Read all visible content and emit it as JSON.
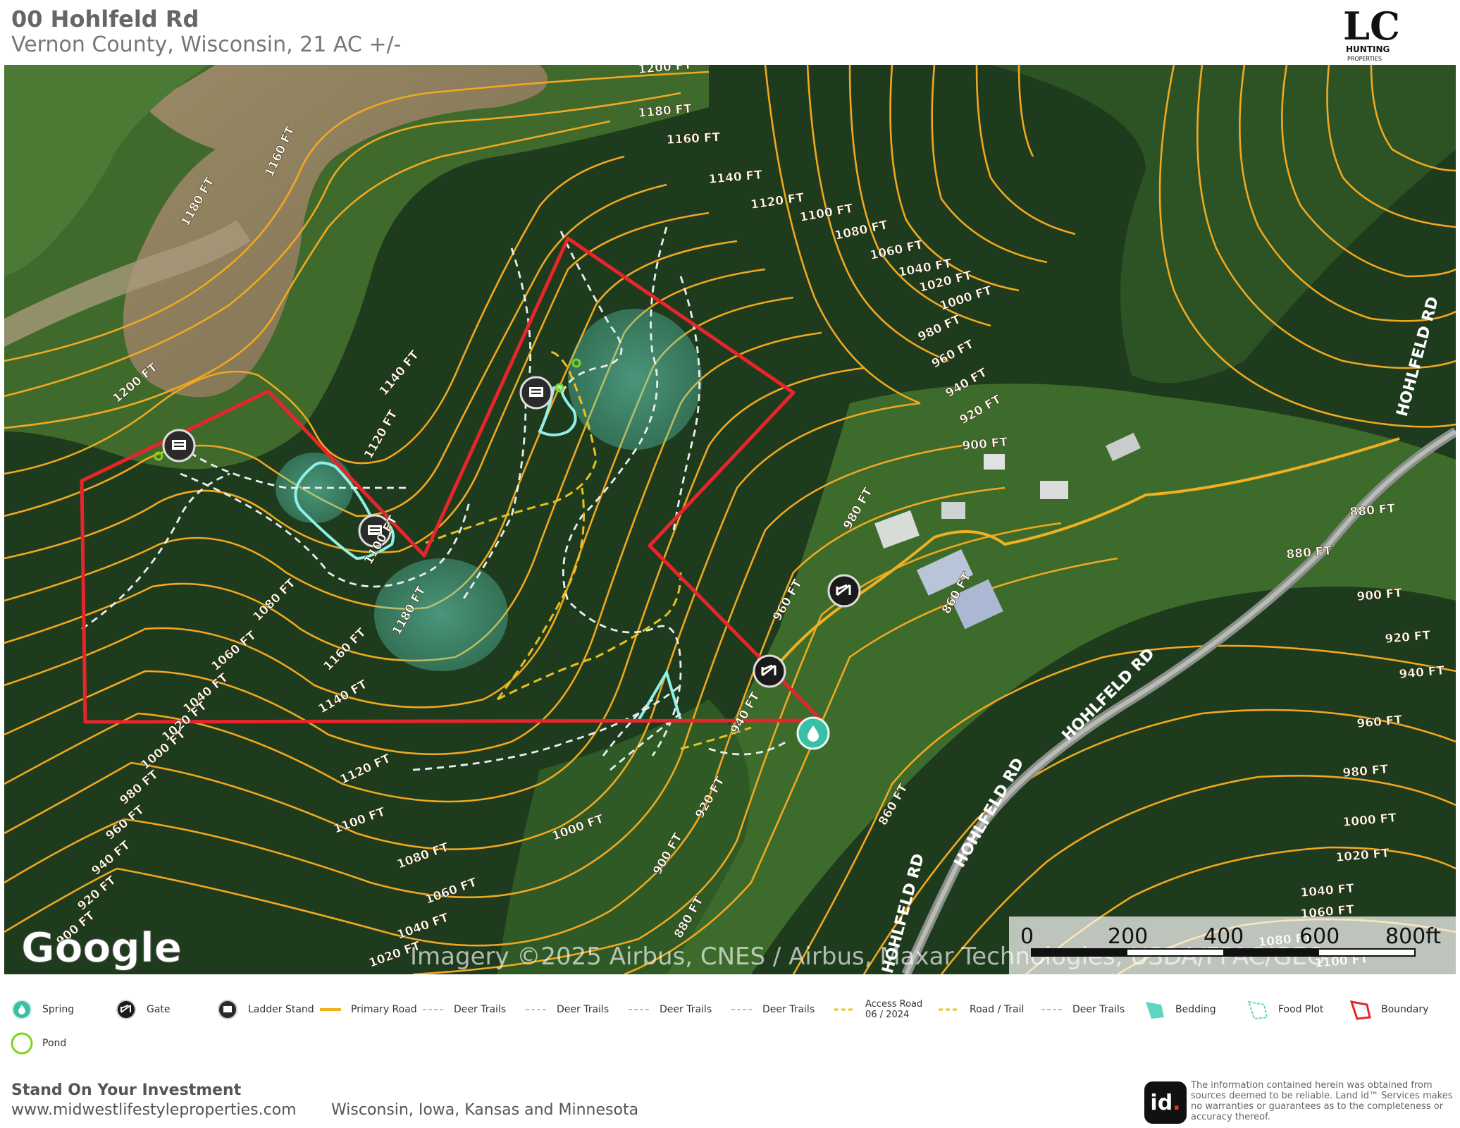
{
  "header": {
    "title": "00 Hohlfeld Rd",
    "subtitle": "Vernon County, Wisconsin, 21 AC +/-"
  },
  "logo": {
    "letters": "LC",
    "line1": "HUNTING",
    "line2": "PROPERTIES"
  },
  "map": {
    "attribution_google": "Google",
    "attribution_imagery": "Imagery ©2025 Airbus, CNES / Airbus, Maxar Technologies, USDA/FPAC/GEO",
    "scale_labels": [
      "0",
      "200",
      "400",
      "600",
      "800ft"
    ],
    "road_labels": [
      "HOHLFELD RD",
      "HOHLFELD RD",
      "HOHLFELD RD",
      "HOHLFELD RD"
    ],
    "contour_labels": [
      "1200 FT",
      "1180 FT",
      "1160 FT",
      "1140 FT",
      "1120 FT",
      "1100 FT",
      "1080 FT",
      "1060 FT",
      "1040 FT",
      "1020 FT",
      "1000 FT",
      "980 FT",
      "960 FT",
      "940 FT",
      "920 FT",
      "900 FT",
      "880 FT",
      "860 FT",
      "1200 FT",
      "1180 FT",
      "1160 FT",
      "1140 FT",
      "1120 FT",
      "1100 FT",
      "1080 FT",
      "1060 FT",
      "1040 FT",
      "1020 FT",
      "1000 FT",
      "980 FT",
      "960 FT",
      "940 FT",
      "920 FT",
      "900 FT",
      "880 FT",
      "900 FT",
      "920 FT",
      "940 FT",
      "960 FT",
      "980 FT",
      "1000 FT",
      "1020 FT",
      "1040 FT",
      "1060 FT",
      "1080 FT",
      "1100 FT",
      "1180 FT",
      "1160 FT",
      "1140 FT",
      "1120 FT",
      "1100 FT",
      "1080 FT",
      "1060 FT",
      "1040 FT",
      "1020 FT",
      "1000 FT",
      "980 FT",
      "960 FT",
      "940 FT",
      "920 FT",
      "900 FT",
      "880 FT",
      "860 FT"
    ],
    "colors": {
      "boundary": "#e8252a",
      "contour": "#f0a820",
      "deer_trail": "#e8eef0",
      "access_road": "#e8c020",
      "food_plot": "#8ff0e8",
      "bedding": "#5cd6c0",
      "pond": "#7ed321",
      "spring": "#39bfa6"
    }
  },
  "legend": {
    "items": [
      {
        "label": "Spring",
        "icon": "spring-icon"
      },
      {
        "label": "Gate",
        "icon": "gate-icon"
      },
      {
        "label": "Ladder Stand",
        "icon": "ladder-stand-icon"
      },
      {
        "label": "Primary Road",
        "icon": "primary-road-icon"
      },
      {
        "label": "Deer Trails",
        "icon": "deer-trail-icon"
      },
      {
        "label": "Deer Trails",
        "icon": "deer-trail-icon"
      },
      {
        "label": "Deer Trails",
        "icon": "deer-trail-icon"
      },
      {
        "label": "Deer Trails",
        "icon": "deer-trail-icon"
      },
      {
        "label": "Access Road",
        "label2": "06 / 2024",
        "icon": "access-road-icon"
      },
      {
        "label": "Road / Trail",
        "icon": "road-trail-icon"
      },
      {
        "label": "Deer Trails",
        "icon": "deer-trail-icon"
      },
      {
        "label": "Bedding",
        "icon": "bedding-icon"
      },
      {
        "label": "Food Plot",
        "icon": "food-plot-icon"
      },
      {
        "label": "Boundary",
        "icon": "boundary-icon"
      },
      {
        "label": "Pond",
        "icon": "pond-icon"
      }
    ]
  },
  "footer": {
    "slogan": "Stand On Your Investment",
    "url": "www.midwestlifestyleproperties.com",
    "states": "Wisconsin, Iowa, Kansas and Minnesota",
    "landid_logo": "id",
    "disclaimer": "The information contained herein was obtained from sources deemed to be reliable. Land id™ Services makes no warranties or guarantees as to the completeness or accuracy thereof."
  }
}
